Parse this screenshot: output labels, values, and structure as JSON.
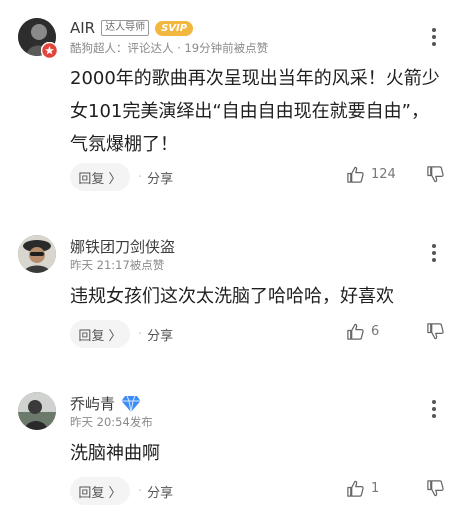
{
  "comments": [
    {
      "username": "AIR",
      "badge": "达人导师",
      "vip": "SVIP",
      "meta": "酷狗超人：评论达人 · 19分钟前被点赞",
      "text": "2000年的歌曲再次呈现出当年的风采！火箭少女101完美演绎出“自由自由现在就要自由”，气氛爆棚了！",
      "reply_label": "回复 〉",
      "share_sep": "·",
      "share_label": "分享",
      "likes": "124"
    },
    {
      "username": "娜铁团刀剑侠盗",
      "meta": "昨天 21:17被点赞",
      "text": "违规女孩们这次太洗脑了哈哈哈，好喜欢",
      "reply_label": "回复 〉",
      "share_sep": "·",
      "share_label": "分享",
      "likes": "6"
    },
    {
      "username": "乔屿青",
      "meta": "昨天 20:54发布",
      "text": "洗脑神曲啊",
      "reply_label": "回复 〉",
      "share_sep": "·",
      "share_label": "分享",
      "likes": "1"
    }
  ],
  "colors": {
    "svip": "#f1b73e",
    "diamond": "#3d8df5",
    "badge_red": "#e0443a",
    "text": "#1f1f1f",
    "meta": "#8a8a8a"
  }
}
